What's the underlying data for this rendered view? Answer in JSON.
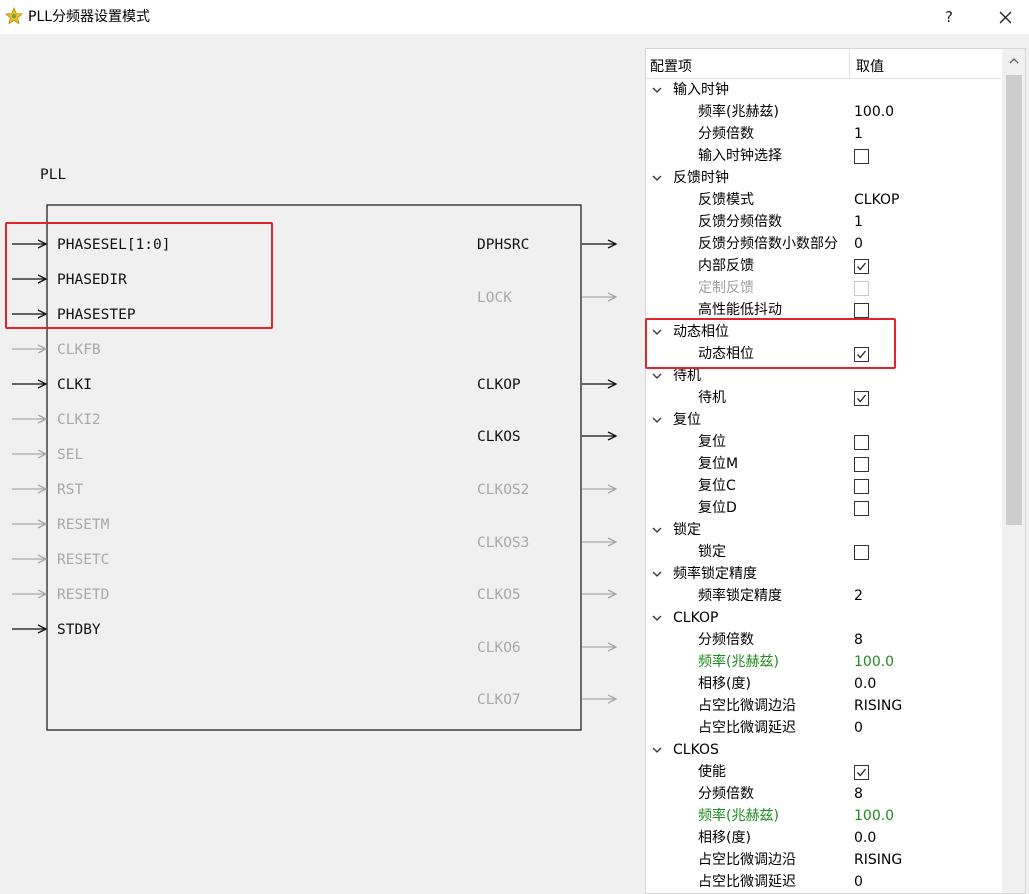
{
  "window": {
    "title": "PLL分频器设置模式",
    "help_label": "?"
  },
  "diagram": {
    "block_label": "PLL",
    "left_pins": [
      {
        "name": "PHASESEL[1:0]",
        "active": true
      },
      {
        "name": "PHASEDIR",
        "active": true
      },
      {
        "name": "PHASESTEP",
        "active": true
      },
      {
        "name": "CLKFB",
        "active": false
      },
      {
        "name": "CLKI",
        "active": true
      },
      {
        "name": "CLKI2",
        "active": false
      },
      {
        "name": "SEL",
        "active": false
      },
      {
        "name": "RST",
        "active": false
      },
      {
        "name": "RESETM",
        "active": false
      },
      {
        "name": "RESETC",
        "active": false
      },
      {
        "name": "RESETD",
        "active": false
      },
      {
        "name": "STDBY",
        "active": true
      }
    ],
    "right_pins": [
      {
        "name": "DPHSRC",
        "active": true
      },
      {
        "name": "LOCK",
        "active": false
      },
      {
        "name": "CLKOP",
        "active": true
      },
      {
        "name": "CLKOS",
        "active": true
      },
      {
        "name": "CLKOS2",
        "active": false
      },
      {
        "name": "CLKOS3",
        "active": false
      },
      {
        "name": "CLKO5",
        "active": false
      },
      {
        "name": "CLKO6",
        "active": false
      },
      {
        "name": "CLKO7",
        "active": false
      }
    ]
  },
  "panel": {
    "col_item": "配置项",
    "col_value": "取值",
    "rows": [
      {
        "type": "group",
        "label": "输入时钟"
      },
      {
        "type": "prop",
        "label": "频率(兆赫兹)",
        "value": "100.0"
      },
      {
        "type": "prop",
        "label": "分频倍数",
        "value": "1"
      },
      {
        "type": "prop",
        "label": "输入时钟选择",
        "checkbox": false
      },
      {
        "type": "group",
        "label": "反馈时钟"
      },
      {
        "type": "prop",
        "label": "反馈模式",
        "value": "CLKOP"
      },
      {
        "type": "prop",
        "label": "反馈分频倍数",
        "value": "1"
      },
      {
        "type": "prop",
        "label": "反馈分频倍数小数部分",
        "value": "0"
      },
      {
        "type": "prop",
        "label": "内部反馈",
        "checkbox": true
      },
      {
        "type": "prop",
        "label": "定制反馈",
        "checkbox": false,
        "disabled": true
      },
      {
        "type": "prop",
        "label": "高性能低抖动",
        "checkbox": false
      },
      {
        "type": "group",
        "label": "动态相位"
      },
      {
        "type": "prop",
        "label": "动态相位",
        "checkbox": true
      },
      {
        "type": "group",
        "label": "待机"
      },
      {
        "type": "prop",
        "label": "待机",
        "checkbox": true
      },
      {
        "type": "group",
        "label": "复位"
      },
      {
        "type": "prop",
        "label": "复位",
        "checkbox": false
      },
      {
        "type": "prop",
        "label": "复位M",
        "checkbox": false
      },
      {
        "type": "prop",
        "label": "复位C",
        "checkbox": false
      },
      {
        "type": "prop",
        "label": "复位D",
        "checkbox": false
      },
      {
        "type": "group",
        "label": "锁定"
      },
      {
        "type": "prop",
        "label": "锁定",
        "checkbox": false
      },
      {
        "type": "group",
        "label": "频率锁定精度"
      },
      {
        "type": "prop",
        "label": "频率锁定精度",
        "value": "2"
      },
      {
        "type": "group",
        "label": "CLKOP"
      },
      {
        "type": "prop",
        "label": "分频倍数",
        "value": "8"
      },
      {
        "type": "prop",
        "label": "频率(兆赫兹)",
        "value": "100.0",
        "highlight": true
      },
      {
        "type": "prop",
        "label": "相移(度)",
        "value": "0.0"
      },
      {
        "type": "prop",
        "label": "占空比微调边沿",
        "value": "RISING"
      },
      {
        "type": "prop",
        "label": "占空比微调延迟",
        "value": "0"
      },
      {
        "type": "group",
        "label": "CLKOS"
      },
      {
        "type": "prop",
        "label": "使能",
        "checkbox": true
      },
      {
        "type": "prop",
        "label": "分频倍数",
        "value": "8"
      },
      {
        "type": "prop",
        "label": "频率(兆赫兹)",
        "value": "100.0",
        "highlight": true
      },
      {
        "type": "prop",
        "label": "相移(度)",
        "value": "0.0"
      },
      {
        "type": "prop",
        "label": "占空比微调边沿",
        "value": "RISING"
      },
      {
        "type": "prop",
        "label": "占空比微调延迟",
        "value": "0"
      }
    ]
  },
  "colors": {
    "active": "#111111",
    "inactive": "#a8a8a8",
    "highlight_box": "#e0242a",
    "green_value": "#1e8c1e"
  }
}
